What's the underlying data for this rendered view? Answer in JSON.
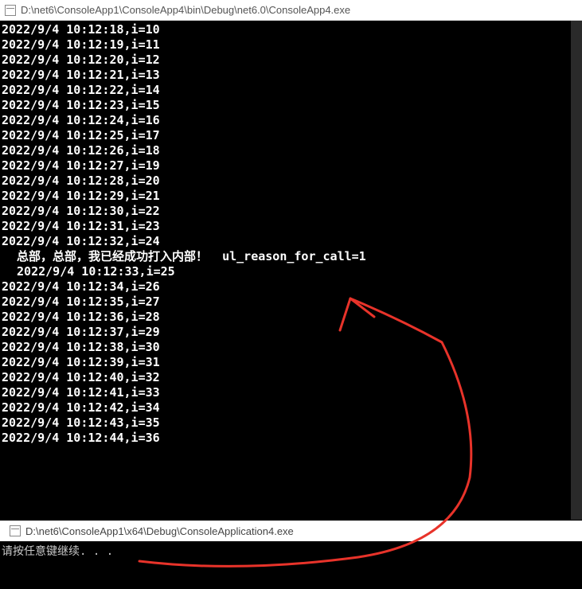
{
  "window1": {
    "title": "D:\\net6\\ConsoleApp1\\ConsoleApp4\\bin\\Debug\\net6.0\\ConsoleApp4.exe",
    "lines": [
      "2022/9/4 10:12:18,i=10",
      "2022/9/4 10:12:19,i=11",
      "2022/9/4 10:12:20,i=12",
      "2022/9/4 10:12:21,i=13",
      "2022/9/4 10:12:22,i=14",
      "2022/9/4 10:12:23,i=15",
      "2022/9/4 10:12:24,i=16",
      "2022/9/4 10:12:25,i=17",
      "2022/9/4 10:12:26,i=18",
      "2022/9/4 10:12:27,i=19",
      "2022/9/4 10:12:28,i=20",
      "2022/9/4 10:12:29,i=21",
      "2022/9/4 10:12:30,i=22",
      "2022/9/4 10:12:31,i=23",
      "2022/9/4 10:12:32,i=24"
    ],
    "inject_line": " 总部，总部，我已经成功打入内部！  ul_reason_for_call=1",
    "spaced_line": " 2022/9/4 10:12:33,i=25",
    "lines2": [
      "2022/9/4 10:12:34,i=26",
      "2022/9/4 10:12:35,i=27",
      "2022/9/4 10:12:36,i=28",
      "2022/9/4 10:12:37,i=29",
      "2022/9/4 10:12:38,i=30",
      "2022/9/4 10:12:39,i=31",
      "2022/9/4 10:12:40,i=32",
      "2022/9/4 10:12:41,i=33",
      "2022/9/4 10:12:42,i=34",
      "2022/9/4 10:12:43,i=35",
      "2022/9/4 10:12:44,i=36"
    ]
  },
  "window2": {
    "title": "D:\\net6\\ConsoleApp1\\x64\\Debug\\ConsoleApplication4.exe",
    "prompt": "请按任意键继续. . ."
  },
  "annotation": {
    "color": "#e8332a"
  }
}
